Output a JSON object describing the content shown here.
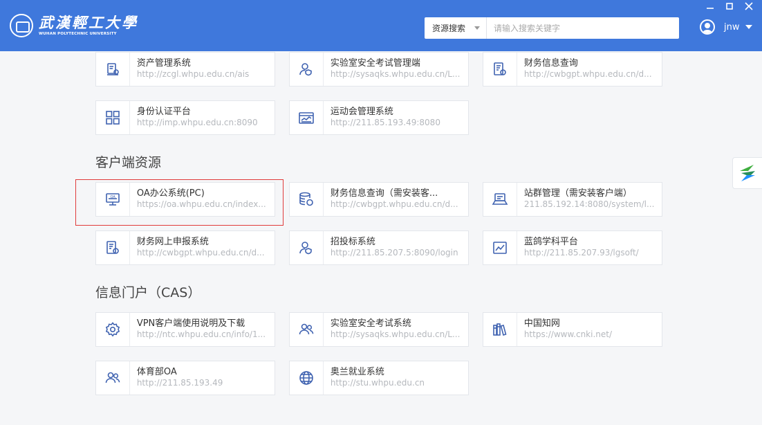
{
  "header": {
    "logo_cn": "武漢輕工大學",
    "logo_en": "WUHAN POLYTECHNIC UNIVERSITY",
    "search_scope": "资源搜索",
    "search_placeholder": "请输入搜索关键字",
    "user_name": "jnw",
    "window_controls": [
      "minimize",
      "maximize",
      "close"
    ]
  },
  "sections": [
    {
      "title": "",
      "items": [
        {
          "title": "资产管理系统",
          "url": "http://zcgl.whpu.edu.cn/ais",
          "icon": "asset-icon"
        },
        {
          "title": "实验室安全考试管理端",
          "url": "http://sysaqks.whpu.edu.cn/L...",
          "icon": "user-shield-icon"
        },
        {
          "title": "财务信息查询",
          "url": "http://cwbgpt.whpu.edu.cn/d...",
          "icon": "finance-doc-icon"
        },
        {
          "title": "身份认证平台",
          "url": "http://imp.whpu.edu.cn:8090",
          "icon": "grid-icon"
        },
        {
          "title": "运动会管理系统",
          "url": "http://211.85.193.49:8080",
          "icon": "dashboard-icon"
        }
      ]
    },
    {
      "title": "客户端资源",
      "items": [
        {
          "title": "OA办公系统(PC)",
          "url": "https://oa.whpu.edu.cn/index...",
          "icon": "oa-monitor-icon"
        },
        {
          "title": "财务信息查询（需安装客...",
          "url": "http://cwbgpt.whpu.edu.cn/d...",
          "icon": "database-yen-icon"
        },
        {
          "title": "站群管理（需安装客户端）",
          "url": "211.85.192.14:8080/system/l...",
          "icon": "laptop-icon"
        },
        {
          "title": "财务网上申报系统",
          "url": "http://cwbgpt.whpu.edu.cn/d...",
          "icon": "finance-doc-icon"
        },
        {
          "title": "招投标系统",
          "url": "http://211.85.207.5:8090/login",
          "icon": "user-shield-icon"
        },
        {
          "title": "蓝鸽学科平台",
          "url": "http://211.85.207.93/lgsoft/",
          "icon": "chart-icon"
        }
      ]
    },
    {
      "title": "信息门户（CAS）",
      "items": [
        {
          "title": "VPN客户端使用说明及下载",
          "url": "http://ntc.whpu.edu.cn/info/1...",
          "icon": "gear-icon"
        },
        {
          "title": "实验室安全考试系统",
          "url": "http://sysaqks.whpu.edu.cn/L...",
          "icon": "users-icon"
        },
        {
          "title": "中国知网",
          "url": "https://www.cnki.net/",
          "icon": "books-icon"
        },
        {
          "title": "体育部OA",
          "url": "http://211.85.193.49",
          "icon": "users-icon"
        },
        {
          "title": "奥兰就业系统",
          "url": "http://stu.whpu.edu.cn",
          "icon": "globe-icon"
        }
      ]
    }
  ],
  "colors": {
    "header": "#3f78dc",
    "icon": "#3f62b0",
    "highlight": "#e03a3a"
  }
}
